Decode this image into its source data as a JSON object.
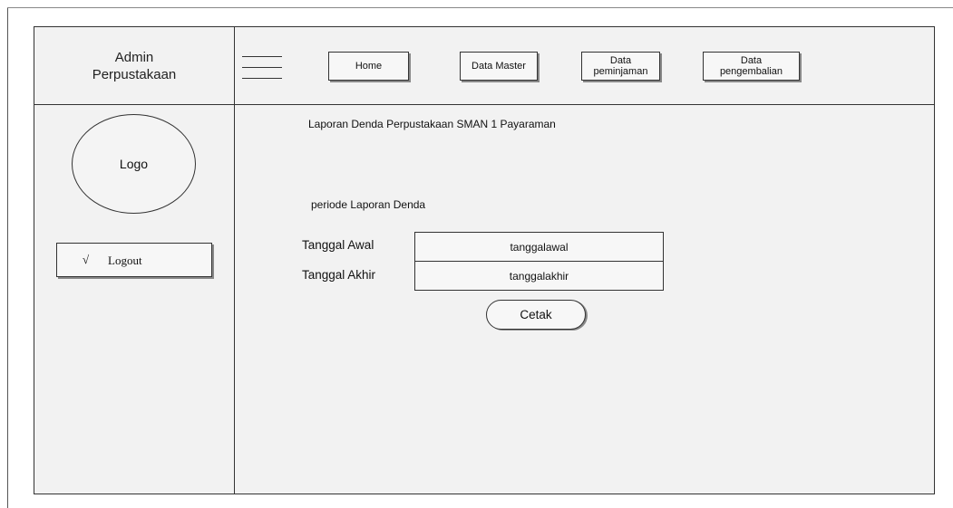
{
  "header": {
    "brand_line1": "Admin",
    "brand_line2": "Perpustakaan"
  },
  "nav": {
    "menu_icon": "hamburger-menu-icon",
    "home": "Home",
    "data_master": "Data Master",
    "peminjaman_line1": "Data",
    "peminjaman_line2": "peminjaman",
    "pengembalian_line1": "Data",
    "pengembalian_line2": "pengembalian"
  },
  "sidebar": {
    "logo": "Logo",
    "logout_icon": "√",
    "logout": "Logout"
  },
  "content": {
    "title": "Laporan Denda Perpustakaan SMAN 1 Payaraman",
    "period_label": "periode Laporan Denda",
    "start_label": "Tanggal Awal",
    "start_value": "tanggalawal",
    "end_label": "Tanggal Akhir",
    "end_value": "tanggalakhir",
    "print_button": "Cetak"
  }
}
